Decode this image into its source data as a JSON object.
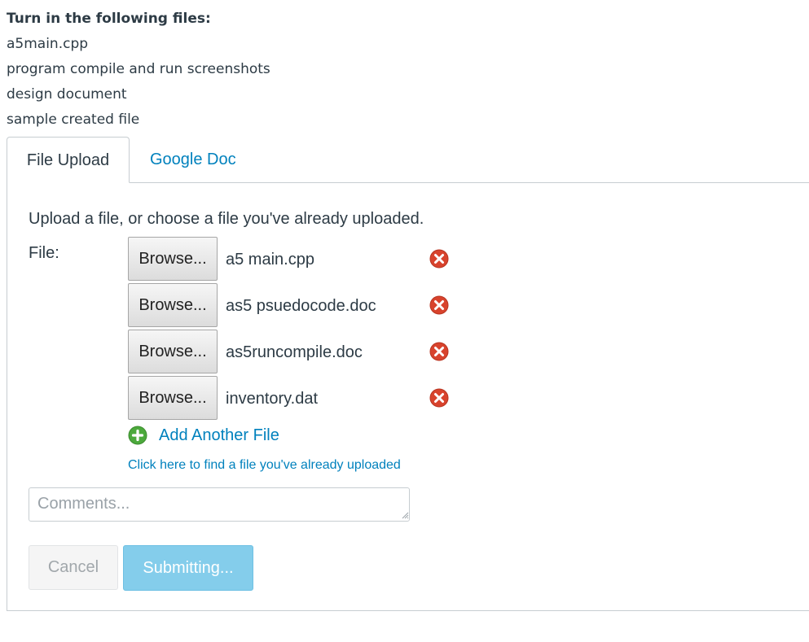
{
  "instructions": {
    "heading": "Turn in the following files:",
    "files": [
      "a5main.cpp",
      "program compile and run screenshots",
      "design document",
      "sample created file"
    ]
  },
  "tabs": [
    {
      "label": "File Upload",
      "active": true
    },
    {
      "label": "Google Doc",
      "active": false
    }
  ],
  "upload": {
    "prompt": "Upload a file, or choose a file you've already uploaded.",
    "file_label": "File:",
    "rows": [
      {
        "browse_label": "Browse...",
        "file_name": "a5 main.cpp"
      },
      {
        "browse_label": "Browse...",
        "file_name": "as5 psuedocode.doc"
      },
      {
        "browse_label": "Browse...",
        "file_name": "as5runcompile.doc"
      },
      {
        "browse_label": "Browse...",
        "file_name": "inventory.dat"
      }
    ],
    "add_another": "Add Another File",
    "find_uploaded": "Click here to find a file you've already uploaded"
  },
  "comments": {
    "placeholder": "Comments...",
    "value": ""
  },
  "actions": {
    "cancel": "Cancel",
    "submit": "Submitting..."
  },
  "colors": {
    "link": "#0081bd",
    "remove": "#d8432d",
    "add": "#4ca93c",
    "submit_bg": "#84cdeb"
  }
}
